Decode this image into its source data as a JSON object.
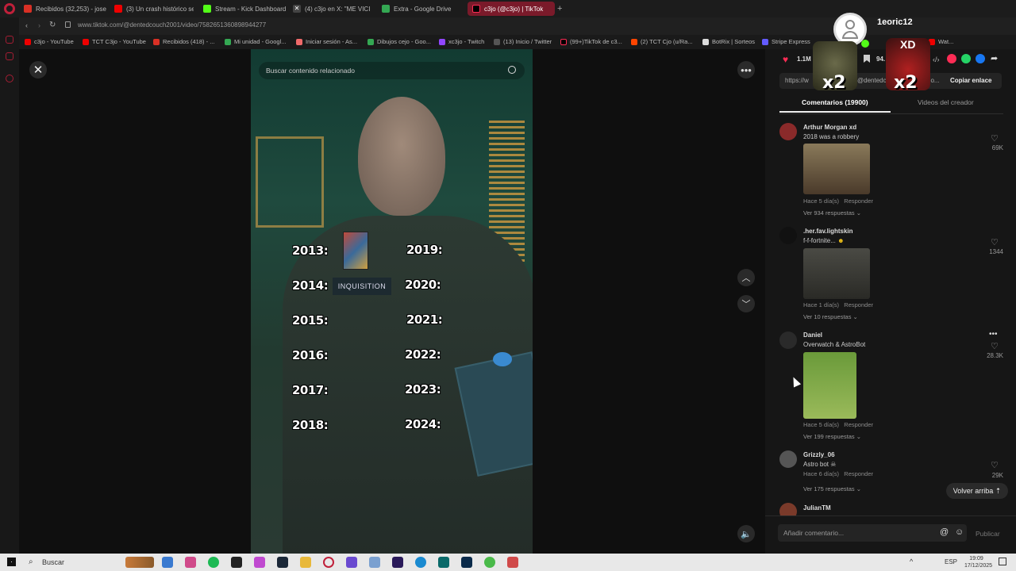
{
  "browser": {
    "tabs": [
      {
        "label": "Recibidos (32,253) - jose"
      },
      {
        "label": "(3) Un crash histórico se"
      },
      {
        "label": "Stream - Kick Dashboard"
      },
      {
        "label": "(4) c3jo en X: \"ME VICI"
      },
      {
        "label": "Extra - Google Drive"
      },
      {
        "label": "c3jo (@c3jo) | TikTok"
      }
    ],
    "url": "www.tiktok.com/@dentedcouch2001/video/7582651360898944277",
    "bookmarks": [
      "c3jo - YouTube",
      "TCT C3jo - YouTube",
      "Recibidos (418) - ...",
      "Mi unidad - Googl...",
      "Iniciar sesión - As...",
      "Dibujos cejo - Goo...",
      "xc3jo - Twitch",
      "(13) Inicio / Twitter",
      "(99+)TikTok de c3...",
      "(2) TCT Cjo (u/Ra...",
      "BotRix | Sorteos",
      "Stripe Express",
      "Wat..."
    ]
  },
  "video": {
    "search_placeholder": "Buscar contenido relacionado",
    "years_left": [
      "2013:",
      "2014:",
      "2015:",
      "2016:",
      "2017:",
      "2018:"
    ],
    "years_right": [
      "2019:",
      "2020:",
      "2021:",
      "2022:",
      "2023:",
      "2024:"
    ],
    "inquisition_label": "INQUISITION"
  },
  "stream_overlay": {
    "username": "1eoric12",
    "badge_xd": "XD",
    "multiplier": "x2"
  },
  "panel": {
    "likes_count": "1.1M",
    "saves_count": "94.",
    "link_text": "https://w",
    "link_suffix": "@dentedc",
    "link_tail": "eo...",
    "copy_link": "Copiar enlace",
    "tab_comments": "Comentarios (19900)",
    "tab_creator": "Videos del creador",
    "comments": [
      {
        "user": "Arthur Morgan xd",
        "text": "2018 was a robbery",
        "meta": "Hace 5 día(s)",
        "reply": "Responder",
        "likes": "69K",
        "more": "Ver 934 respuestas"
      },
      {
        "user": ".her.fav.lightskin",
        "text": "f-f-fortnite...",
        "meta": "Hace 1 día(s)",
        "reply": "Responder",
        "likes": "1344",
        "more": "Ver 10 respuestas"
      },
      {
        "user": "Daniel",
        "text": "Overwatch & AstroBot",
        "meta": "Hace 5 día(s)",
        "reply": "Responder",
        "likes": "28.3K",
        "more": "Ver 199 respuestas"
      },
      {
        "user": "Grizzly_06",
        "text": "Astro bot",
        "meta": "Hace 6 día(s)",
        "reply": "Responder",
        "likes": "29K",
        "more": "Ver 175 respuestas"
      },
      {
        "user": "JulianTM"
      }
    ],
    "back_to_top": "Volver arriba",
    "comment_placeholder": "Añadir comentario...",
    "publish": "Publicar"
  },
  "taskbar": {
    "search": "Buscar",
    "lang": "ESP",
    "time": "19:09",
    "date": "17/12/2025"
  },
  "colors": {
    "accent": "#fe2c55",
    "opera": "#c0203a"
  }
}
